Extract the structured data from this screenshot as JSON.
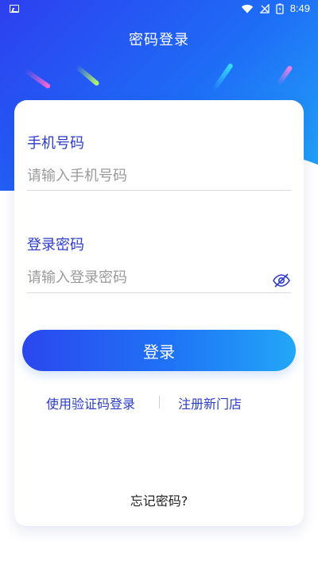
{
  "status_bar": {
    "time": "8:49"
  },
  "header": {
    "title": "密码登录"
  },
  "form": {
    "phone": {
      "label": "手机号码",
      "placeholder": "请输入手机号码",
      "value": ""
    },
    "password": {
      "label": "登录密码",
      "placeholder": "请输入登录密码",
      "value": ""
    }
  },
  "actions": {
    "login_label": "登录",
    "sms_login_label": "使用验证码登录",
    "register_label": "注册新门店",
    "forgot_label": "忘记密码?"
  },
  "icons": {
    "status_left": "image-icon",
    "wifi": "wifi-icon",
    "signal": "signal-off-icon",
    "battery": "battery-charging-icon",
    "eye": "eye-off-icon"
  },
  "colors": {
    "brand_blue": "#2b3cc8",
    "gradient_start": "#2b47ee",
    "gradient_end": "#22a7f7",
    "placeholder": "#9a9a9a"
  }
}
